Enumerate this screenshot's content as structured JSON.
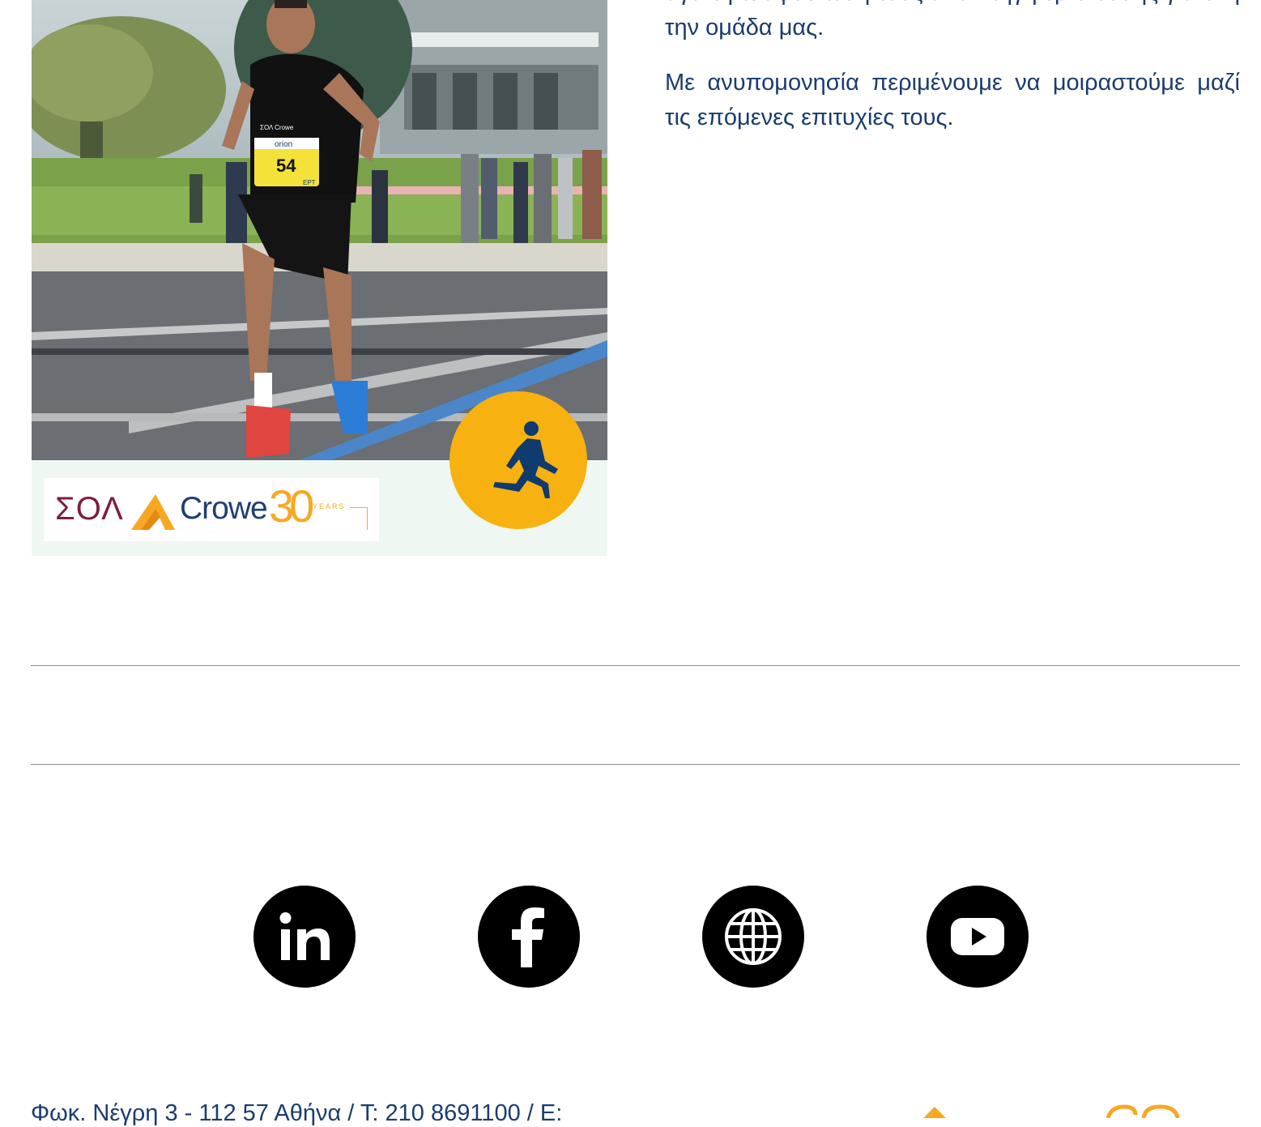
{
  "article": {
    "paragraphs": [
      "αγάπη & αφοσίωση τους είναι πηγή έμπνευσης για όλη την ομάδα μας.",
      "Με ανυπομονησία περιμένουμε να μοιραστούμε μαζί τις επόμενες επιτυχίες τους."
    ]
  },
  "photo": {
    "bib_number": "54",
    "bib_sponsor": "orion",
    "bib_footer": "ΕΡΤ",
    "shirt_text": "ΣΟΛ Crowe"
  },
  "brand": {
    "sol": "ΣΟΛ",
    "crowe": "Crowe",
    "thirty": "30",
    "years": "YEARS"
  },
  "badge": {
    "icon": "runner-icon",
    "color": "#f7b111"
  },
  "social": [
    {
      "name": "linkedin",
      "icon": "linkedin-icon"
    },
    {
      "name": "facebook",
      "icon": "facebook-icon"
    },
    {
      "name": "website",
      "icon": "globe-icon"
    },
    {
      "name": "youtube",
      "icon": "youtube-icon"
    }
  ],
  "footer": {
    "address": "Φωκ. Νέγρη 3 - 112 57 Αθήνα / Τ: 210 8691100 / E:"
  },
  "colors": {
    "brand_navy": "#1a3d6e",
    "brand_burgundy": "#7e1d3c",
    "brand_orange": "#f7a823",
    "badge_yellow": "#f7b111"
  }
}
